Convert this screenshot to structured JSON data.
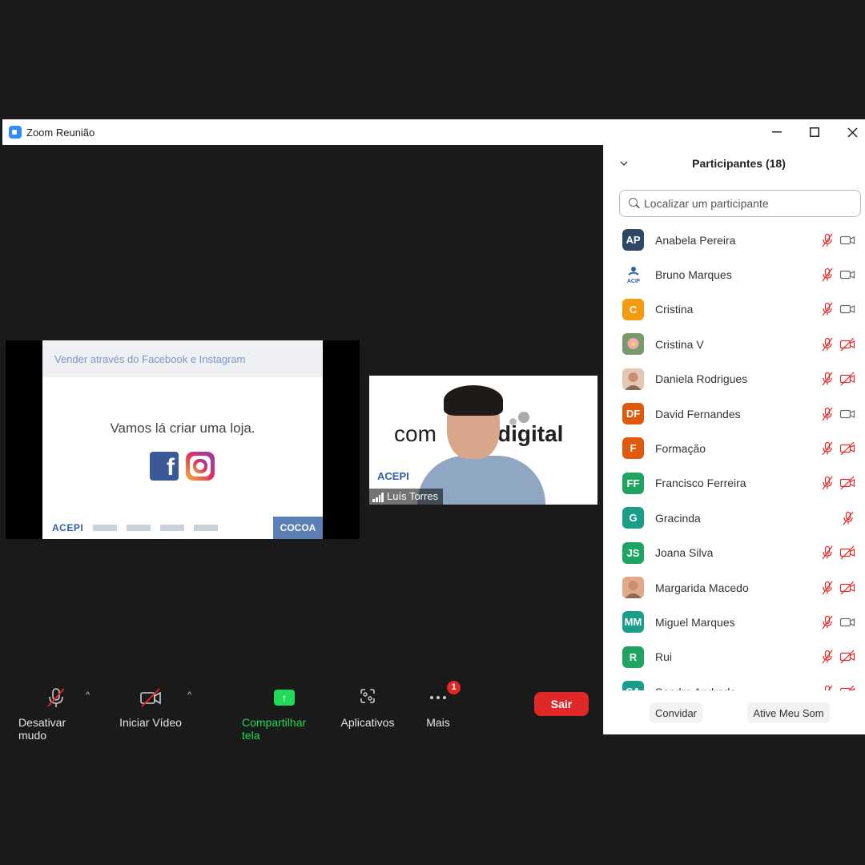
{
  "window": {
    "title": "Zoom Reunião"
  },
  "share": {
    "slide_title": "Vender através do Facebook e Instagram",
    "slide_text": "Vamos lá criar uma loja.",
    "footer_logo_left": "ACEPI",
    "footer_logo_right": "COCOA"
  },
  "video": {
    "brand_left": "com",
    "brand_right": "digital",
    "participant_name": "Luís Torres",
    "logo_text": "ACEPI"
  },
  "toolbar": {
    "mute_label": "Desativar mudo",
    "video_label": "Iniciar Vídeo",
    "share_label": "Compartilhar tela",
    "apps_label": "Aplicativos",
    "more_label": "Mais",
    "more_badge": "1",
    "leave_label": "Sair",
    "colors": {
      "share": "#23d959",
      "leave": "#e02828"
    }
  },
  "panel": {
    "title": "Participantes (18)",
    "search_placeholder": "Localizar um participante",
    "invite_label": "Convidar",
    "unmute_me_label": "Ative Meu Som",
    "participants": [
      {
        "initials": "AP",
        "name": "Anabela Pereira",
        "color": "#2f4866",
        "mic_muted": true,
        "cam": "off-plain"
      },
      {
        "initials": "",
        "name": "Bruno Marques",
        "color": "#ffffff",
        "mic_muted": true,
        "cam": "off-plain",
        "avatar": "acif-logo"
      },
      {
        "initials": "C",
        "name": "Cristina",
        "color": "#f29b11",
        "mic_muted": true,
        "cam": "off-plain"
      },
      {
        "initials": "",
        "name": "Cristina V",
        "color": "#9bc48a",
        "mic_muted": true,
        "cam": "off-red",
        "avatar": "flower-photo"
      },
      {
        "initials": "",
        "name": "Daniela Rodrigues",
        "color": "#e6c7b3",
        "mic_muted": true,
        "cam": "off-red",
        "avatar": "photo"
      },
      {
        "initials": "DF",
        "name": "David Fernandes",
        "color": "#e05a0e",
        "mic_muted": true,
        "cam": "off-plain"
      },
      {
        "initials": "F",
        "name": "Formação",
        "color": "#e05a0e",
        "mic_muted": true,
        "cam": "off-red"
      },
      {
        "initials": "FF",
        "name": "Francisco Ferreira",
        "color": "#1fa463",
        "mic_muted": true,
        "cam": "off-red"
      },
      {
        "initials": "G",
        "name": "Gracinda",
        "color": "#1a9e8a",
        "mic_muted": true,
        "cam": "none"
      },
      {
        "initials": "JS",
        "name": "Joana Silva",
        "color": "#1fa463",
        "mic_muted": true,
        "cam": "off-red"
      },
      {
        "initials": "",
        "name": "Margarida Macedo",
        "color": "#e0a98a",
        "mic_muted": true,
        "cam": "off-red",
        "avatar": "photo"
      },
      {
        "initials": "MM",
        "name": "Miguel Marques",
        "color": "#1a9e8a",
        "mic_muted": true,
        "cam": "off-plain"
      },
      {
        "initials": "R",
        "name": "Rui",
        "color": "#1fa463",
        "mic_muted": true,
        "cam": "off-red"
      },
      {
        "initials": "SA",
        "name": "Sandra Andrade",
        "color": "#1a9e8a",
        "mic_muted": true,
        "cam": "off-red"
      }
    ]
  }
}
